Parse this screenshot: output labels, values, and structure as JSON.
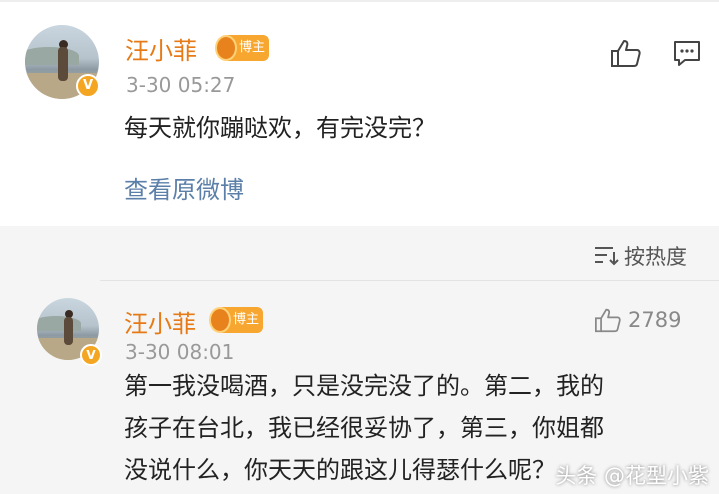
{
  "top_comment": {
    "username": "汪小菲",
    "badge": "博主",
    "time": "3-30 05:27",
    "text": "每天就你蹦哒欢，有完没完？",
    "view_original": "查看原微博"
  },
  "sort_label": "按热度",
  "reply": {
    "username": "汪小菲",
    "badge": "博主",
    "time": "3-30 08:01",
    "likes": "2789",
    "lines": [
      "第一我没喝酒，只是没完没了的。第二，我的",
      "孩子在台北，我已经很妥协了，第三，你姐都",
      "没说什么，你天天的跟这儿得瑟什么呢？"
    ]
  },
  "watermark": "头条 @花型小紫",
  "colors": {
    "username": "#e67a16",
    "badge_bg": "#f7a72f",
    "link": "#5b7fa8",
    "muted": "#999999"
  }
}
